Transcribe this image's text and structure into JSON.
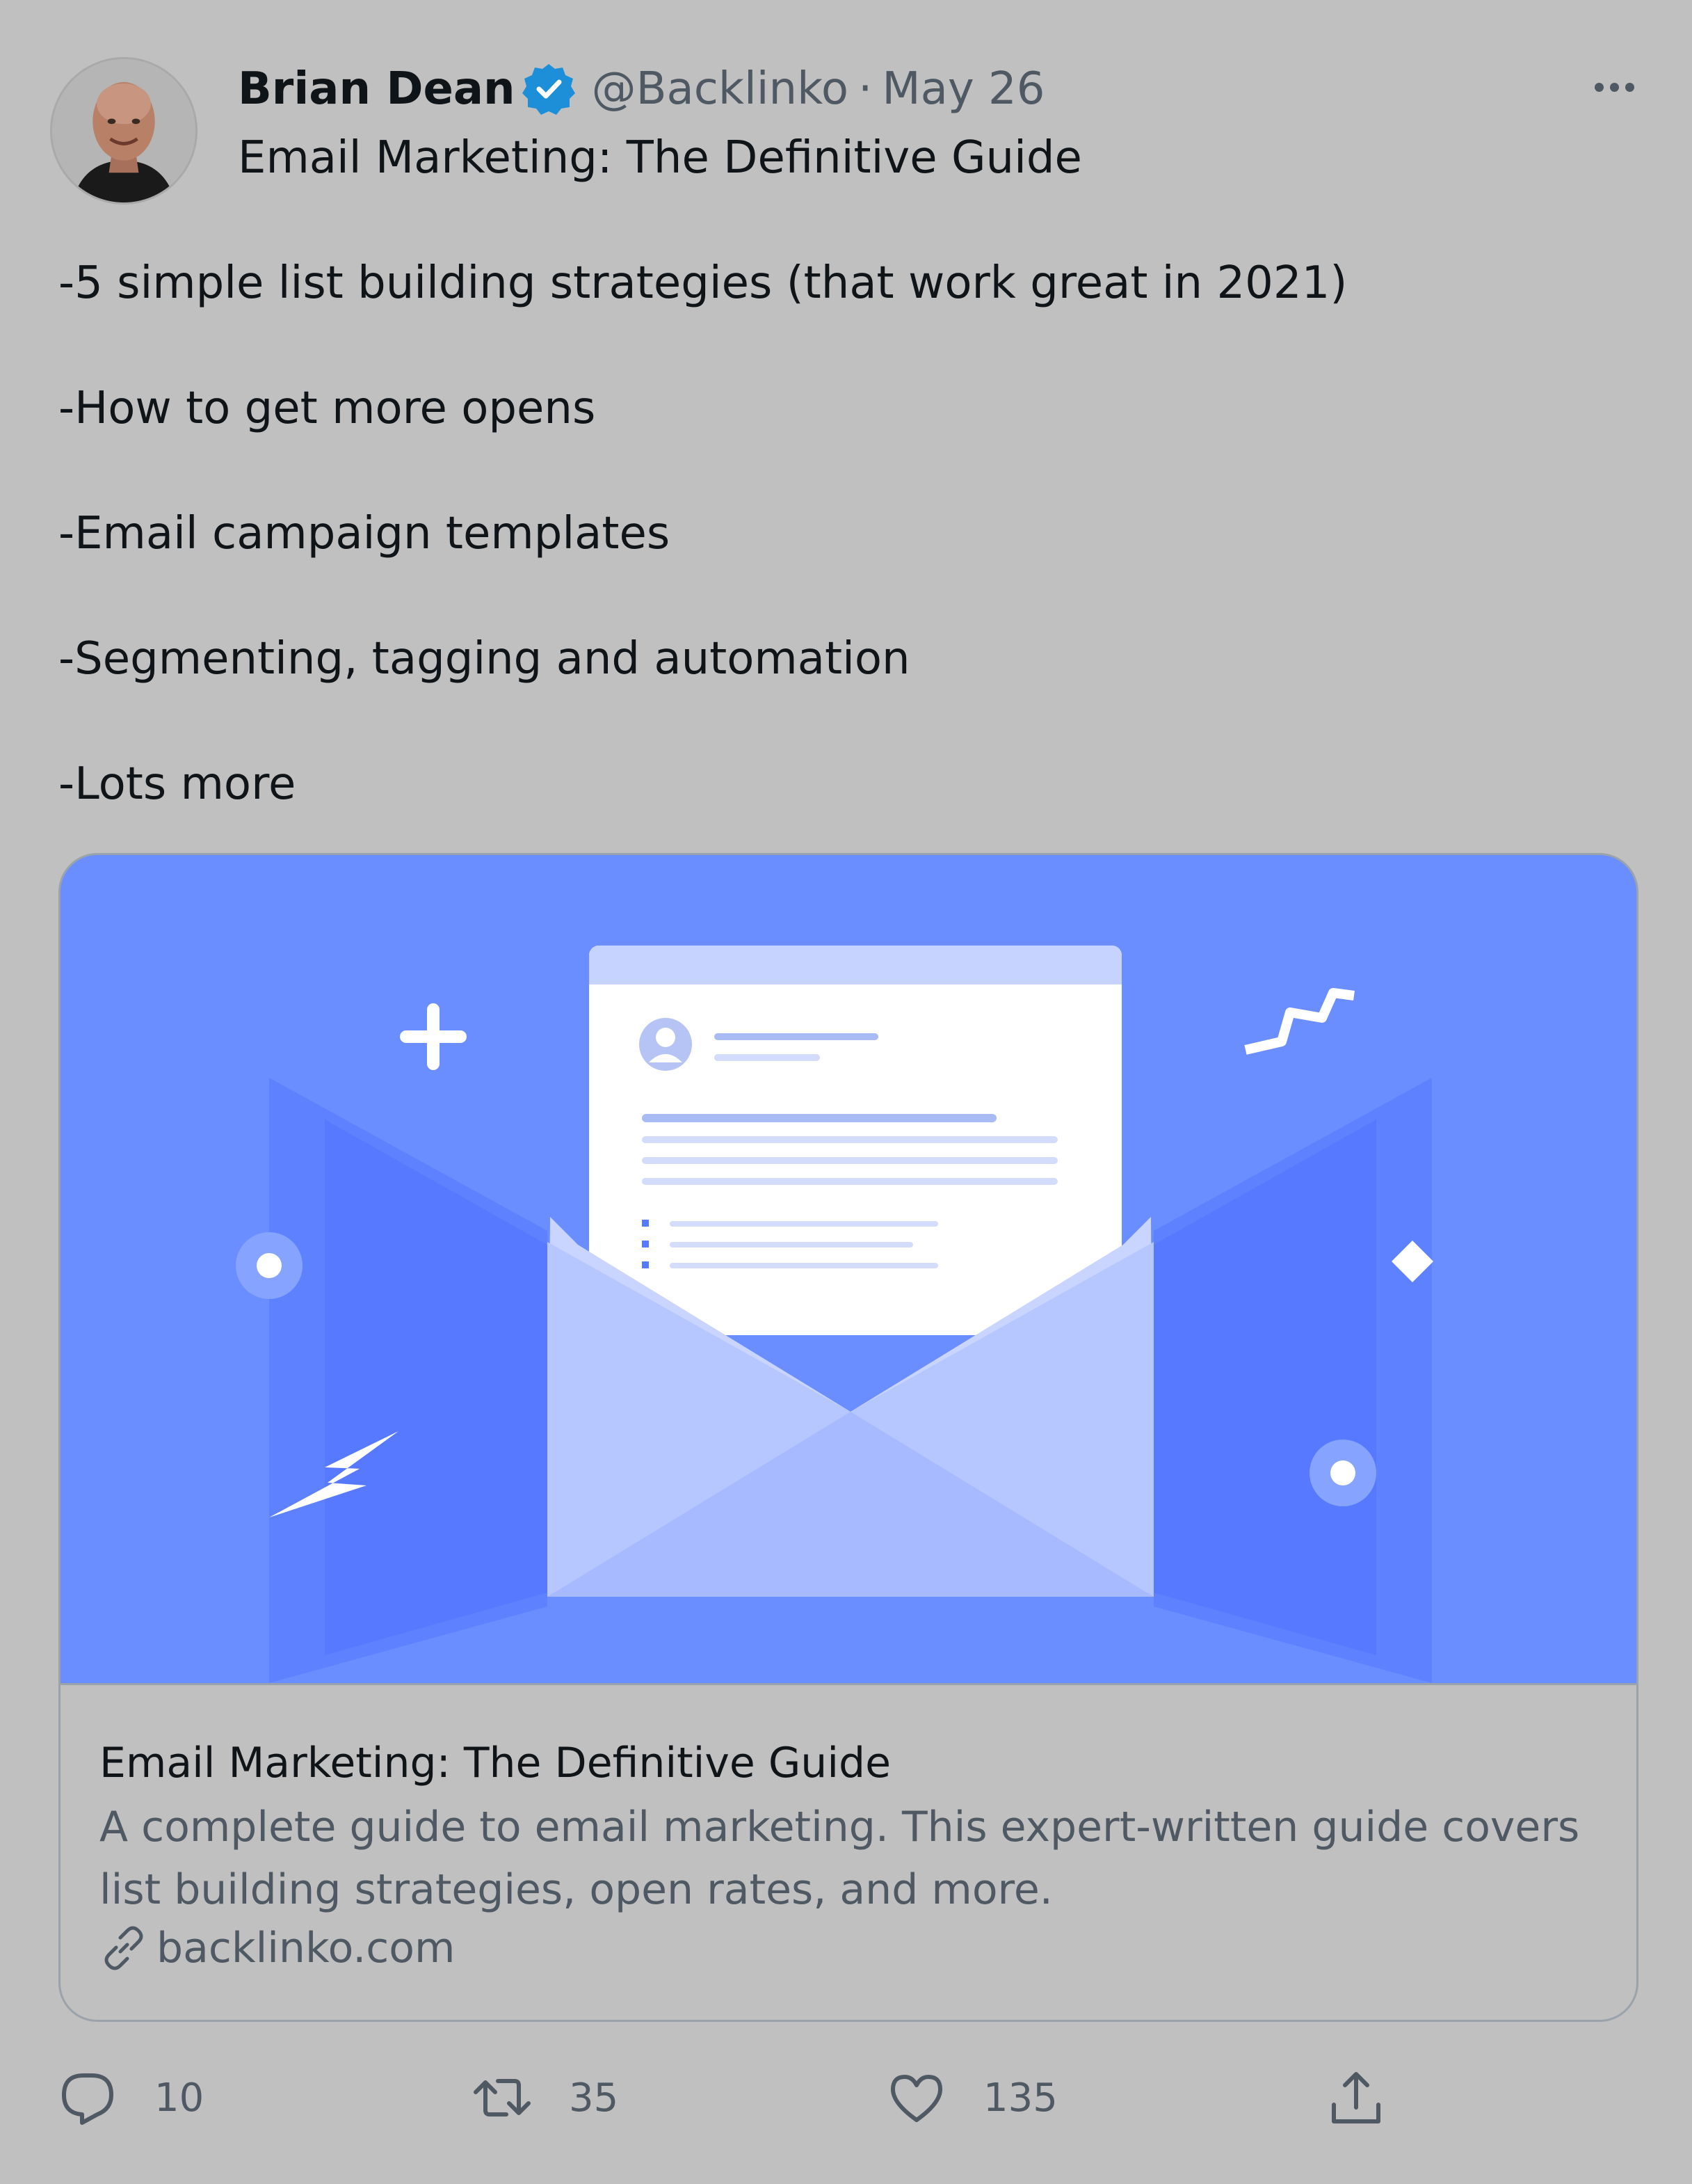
{
  "author": {
    "name": "Brian Dean",
    "handle": "@Backlinko",
    "separator": "·",
    "date": "May 26",
    "verified": true
  },
  "tweet": {
    "headline": "Email Marketing: The Definitive Guide",
    "lines": [
      "-5 simple list building strategies (that work great in 2021)",
      "-How to get more opens",
      "-Email campaign templates",
      "-Segmenting, tagging and automation",
      "-Lots more"
    ]
  },
  "card": {
    "title": "Email Marketing: The Definitive Guide",
    "description": "A complete guide to email marketing. This expert-written guide covers list building strategies, open rates, and more.",
    "domain": "backlinko.com",
    "image_icon": "email-envelope-illustration"
  },
  "actions": {
    "replies": "10",
    "retweets": "35",
    "likes": "135"
  },
  "icons": {
    "verified": "verified-badge-icon",
    "more": "more-options-icon",
    "reply": "reply-icon",
    "retweet": "retweet-icon",
    "like": "heart-icon",
    "share": "share-icon",
    "link": "link-icon"
  },
  "colors": {
    "background": "#c0c0c0",
    "verified_blue": "#1d8fd8",
    "card_image_bg": "#6a8dff",
    "secondary_text": "#4f5963"
  }
}
